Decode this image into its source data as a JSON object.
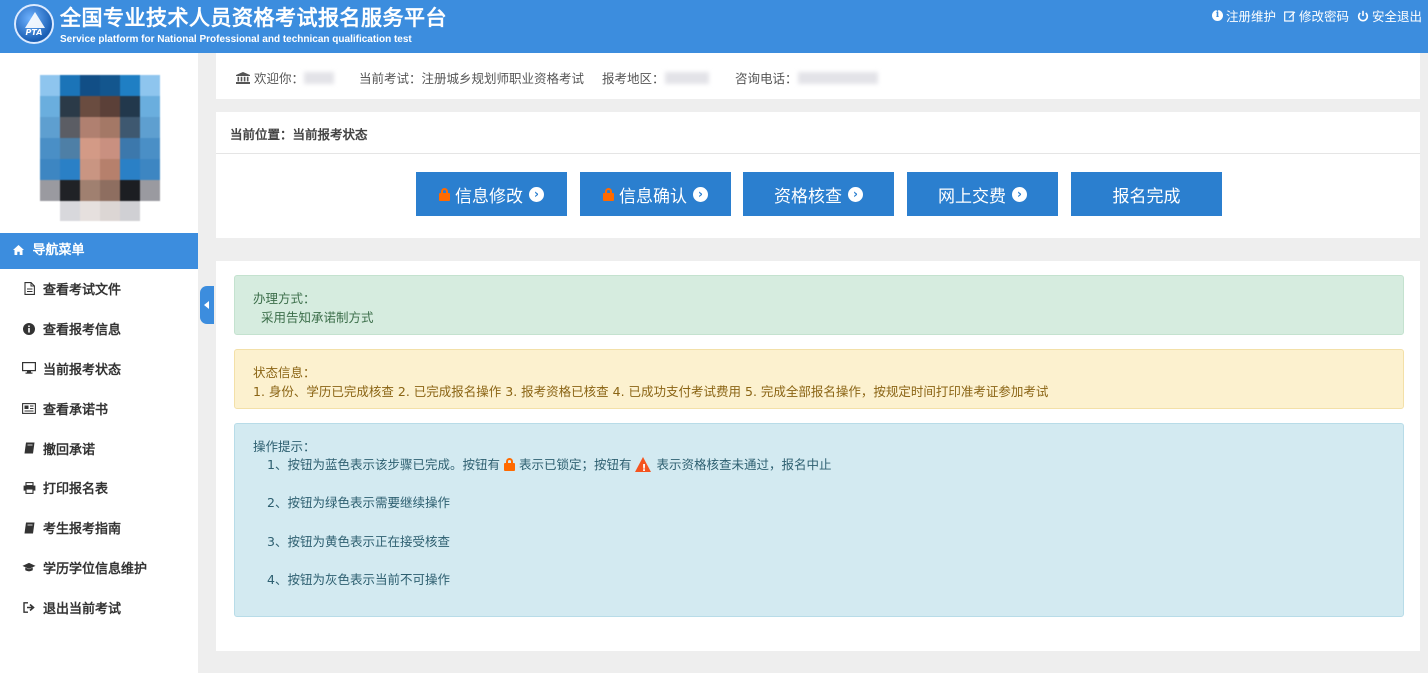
{
  "header": {
    "logo_text": "PTA",
    "title_cn": "全国专业技术人员资格考试报名服务平台",
    "title_en": "Service platform for National Professional and technican qualification test",
    "links": [
      {
        "label": "注册维护",
        "icon": "info-circle-icon"
      },
      {
        "label": "修改密码",
        "icon": "edit-icon"
      },
      {
        "label": "安全退出",
        "icon": "power-icon"
      }
    ]
  },
  "infobar": {
    "welcome_label": "欢迎你：",
    "exam_label": "当前考试：",
    "exam_value": "注册城乡规划师职业资格考试",
    "region_label": "报考地区：",
    "phone_label": "咨询电话："
  },
  "sidebar": {
    "nav_header": "导航菜单",
    "items": [
      {
        "label": "查看考试文件",
        "icon": "file-icon"
      },
      {
        "label": "查看报考信息",
        "icon": "info-icon"
      },
      {
        "label": "当前报考状态",
        "icon": "monitor-icon"
      },
      {
        "label": "查看承诺书",
        "icon": "newspaper-icon"
      },
      {
        "label": "撤回承诺",
        "icon": "book-icon"
      },
      {
        "label": "打印报名表",
        "icon": "printer-icon"
      },
      {
        "label": "考生报考指南",
        "icon": "book-icon"
      },
      {
        "label": "学历学位信息维护",
        "icon": "graduation-cap-icon"
      },
      {
        "label": "退出当前考试",
        "icon": "sign-out-icon"
      }
    ]
  },
  "status_panel": {
    "breadcrumb": "当前位置：当前报考状态",
    "steps": [
      {
        "label": "信息修改",
        "locked": true,
        "arrow": true
      },
      {
        "label": "信息确认",
        "locked": true,
        "arrow": true
      },
      {
        "label": "资格核查",
        "locked": false,
        "arrow": true
      },
      {
        "label": "网上交费",
        "locked": false,
        "arrow": true
      },
      {
        "label": "报名完成",
        "locked": false,
        "arrow": false
      }
    ]
  },
  "alerts": {
    "method_title": "办理方式：",
    "method_value": "采用告知承诺制方式",
    "status_title": "状态信息：",
    "status_value": "1. 身份、学历已完成核查 2. 已完成报名操作 3. 报考资格已核查 4. 已成功支付考试费用 5. 完成全部报名操作，按规定时间打印准考证参加考试",
    "tips_title": "操作提示：",
    "tip1_a": "1、按钮为蓝色表示该步骤已完成。按钮有",
    "tip1_b": "表示已锁定；按钮有",
    "tip1_c": "表示资格核查未通过，报名中止",
    "tip2": "2、按钮为绿色表示需要继续操作",
    "tip3": "3、按钮为黄色表示正在接受核查",
    "tip4": "4、按钮为灰色表示当前不可操作"
  },
  "colors": {
    "primary": "#3c8dde",
    "button": "#2b7fcf",
    "lock": "#ff6a00",
    "warning": "#f5541f"
  }
}
